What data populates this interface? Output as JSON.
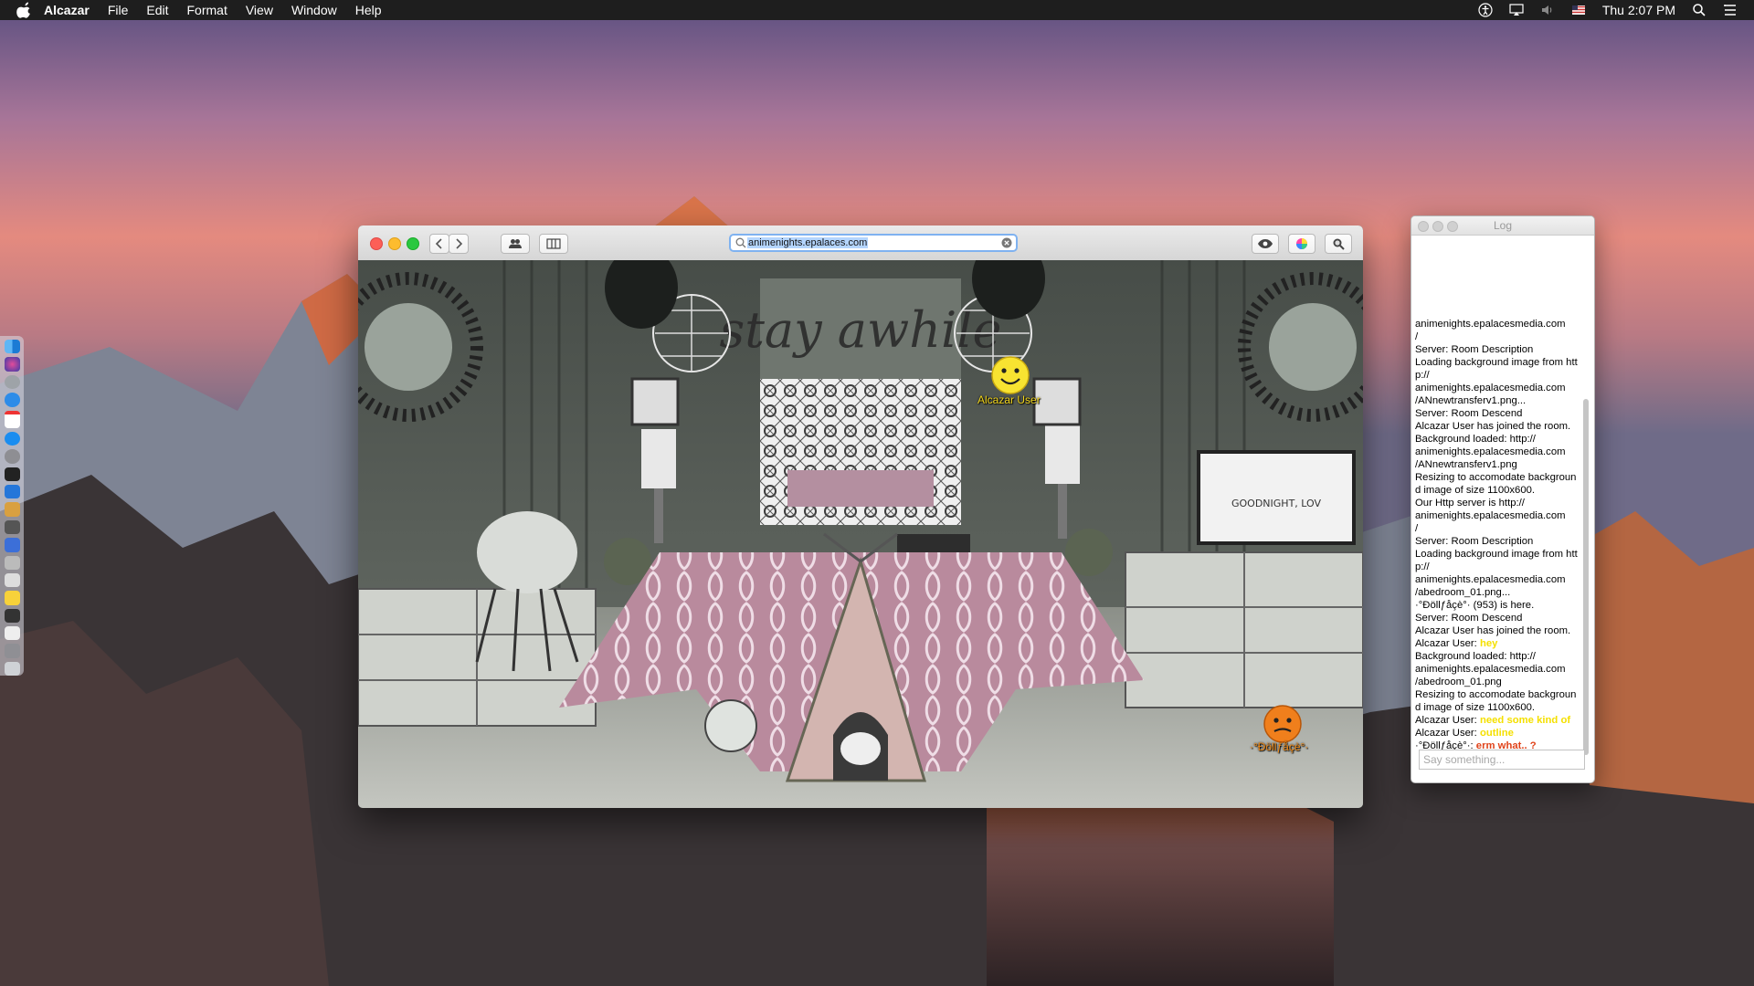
{
  "menubar": {
    "app_name": "Alcazar",
    "menus": [
      "File",
      "Edit",
      "Format",
      "View",
      "Window",
      "Help"
    ],
    "clock": "Thu 2:07 PM"
  },
  "main_window": {
    "url": "animenights.epalaces.com",
    "room": {
      "avatars": [
        {
          "name": "Alcazar User",
          "label_color": "#f2d51c"
        },
        {
          "name": "·°Ðöllƒåçè°·",
          "label_color": "#f28b16"
        }
      ]
    }
  },
  "log_window": {
    "title": "Log",
    "lines": [
      {
        "parts": [
          {
            "t": "animenights.epalacesmedia.com"
          }
        ]
      },
      {
        "parts": [
          {
            "t": "/"
          }
        ]
      },
      {
        "parts": [
          {
            "t": "Server: Room Description"
          }
        ]
      },
      {
        "parts": [
          {
            "t": "Loading background image from http://"
          }
        ]
      },
      {
        "parts": [
          {
            "t": "animenights.epalacesmedia.com"
          }
        ]
      },
      {
        "parts": [
          {
            "t": "/ANnewtransferv1.png..."
          }
        ]
      },
      {
        "parts": [
          {
            "t": "Server: Room Descend"
          }
        ]
      },
      {
        "parts": [
          {
            "t": "Alcazar User has joined the room."
          }
        ]
      },
      {
        "parts": [
          {
            "t": "Background loaded: http://"
          }
        ]
      },
      {
        "parts": [
          {
            "t": "animenights.epalacesmedia.com"
          }
        ]
      },
      {
        "parts": [
          {
            "t": "/ANnewtransferv1.png"
          }
        ]
      },
      {
        "parts": [
          {
            "t": "Resizing to accomodate background image of size 1100x600."
          }
        ]
      },
      {
        "parts": [
          {
            "t": "Our Http server is http://"
          }
        ]
      },
      {
        "parts": [
          {
            "t": "animenights.epalacesmedia.com"
          }
        ]
      },
      {
        "parts": [
          {
            "t": "/"
          }
        ]
      },
      {
        "parts": [
          {
            "t": "Server: Room Description"
          }
        ]
      },
      {
        "parts": [
          {
            "t": "Loading background image from http://"
          }
        ]
      },
      {
        "parts": [
          {
            "t": "animenights.epalacesmedia.com"
          }
        ]
      },
      {
        "parts": [
          {
            "t": "/abedroom_01.png..."
          }
        ]
      },
      {
        "parts": [
          {
            "t": "·°Ðöllƒåçè°· (953) is here."
          }
        ]
      },
      {
        "parts": [
          {
            "t": "Server: Room Descend"
          }
        ]
      },
      {
        "parts": [
          {
            "t": "Alcazar User has joined the room."
          }
        ]
      },
      {
        "parts": [
          {
            "t": "Alcazar User: "
          },
          {
            "t": "hey",
            "c": "yellow"
          }
        ]
      },
      {
        "parts": [
          {
            "t": "Background loaded: http://"
          }
        ]
      },
      {
        "parts": [
          {
            "t": "animenights.epalacesmedia.com"
          }
        ]
      },
      {
        "parts": [
          {
            "t": "/abedroom_01.png"
          }
        ]
      },
      {
        "parts": [
          {
            "t": "Resizing to accomodate background image of size 1100x600."
          }
        ]
      },
      {
        "parts": [
          {
            "t": "Alcazar User: "
          },
          {
            "t": "need some kind of",
            "c": "yellow"
          }
        ]
      },
      {
        "parts": [
          {
            "t": "Alcazar User: "
          },
          {
            "t": "outline",
            "c": "yellow"
          }
        ]
      },
      {
        "parts": [
          {
            "t": "·°Ðöllƒåçè°·: "
          },
          {
            "t": "erm what.. ?",
            "c": "red"
          }
        ]
      }
    ],
    "input_placeholder": "Say something..."
  }
}
